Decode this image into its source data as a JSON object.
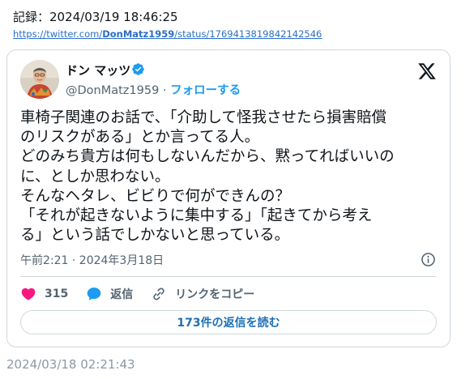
{
  "record": {
    "label": "記録：2024/03/19 18:46:25",
    "url_prefix": "https://twitter.com/",
    "url_user": "DonMatz1959",
    "url_suffix": "/status/1769413819842142546"
  },
  "tweet": {
    "display_name": "ドン マッツ",
    "handle": "@DonMatz1959",
    "separator": " · ",
    "follow_label": "フォローする",
    "text_lines": [
      "車椅子関連のお話で、「介助して怪我させたら損害賠償",
      "のリスクがある」とか言ってる人。",
      "どのみち貴方は何もしないんだから、黙ってればいいの",
      "に、としか思わない。",
      "そんなヘタレ、ビビりで何ができんの？",
      "「それが起きないように集中する」「起きてから考え",
      "る」という話でしかないと思っている。"
    ],
    "timestamp": "午前2:21 · 2024年3月18日",
    "likes": "315",
    "reply_label": "返信",
    "copy_link_label": "リンクをコピー",
    "read_replies_label": "173件の返信を読む"
  },
  "icons": {
    "verified": "verified-badge-icon",
    "x_logo": "x-logo-icon",
    "info": "info-icon",
    "heart": "heart-icon",
    "reply": "reply-bubble-icon",
    "link": "link-icon"
  },
  "colors": {
    "accent": "#1d9bf0",
    "heart": "#f91880",
    "muted": "#536471",
    "border": "#cfd9de"
  },
  "footer": {
    "captured_time": "2024/03/18 02:21:43"
  }
}
